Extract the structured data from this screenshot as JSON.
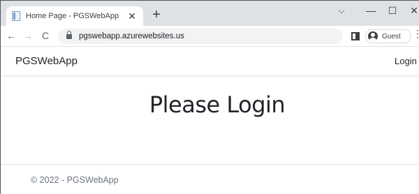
{
  "browser": {
    "tab": {
      "title": "Home Page - PGSWebApp",
      "close": "✕"
    },
    "new_tab": "+",
    "window_controls": {
      "dropdown": "⌵",
      "minimize": "—",
      "maximize": "☐",
      "close": "✕"
    },
    "nav": {
      "back": "←",
      "forward": "→",
      "reload": "C"
    },
    "address_bar": {
      "url": "pgswebapp.azurewebsites.us"
    },
    "profile": {
      "name": "Guest"
    },
    "menu": "⋮"
  },
  "page": {
    "navbar": {
      "brand": "PGSWebApp",
      "login": "Login"
    },
    "heading": "Please Login",
    "footer": "© 2022 - PGSWebApp"
  }
}
